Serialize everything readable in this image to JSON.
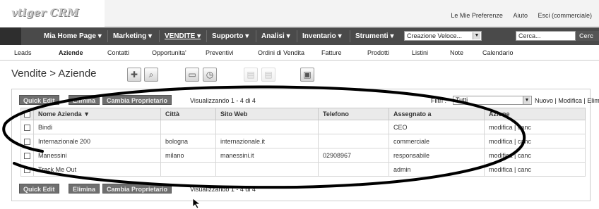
{
  "app": {
    "logo": "vtiger CRM"
  },
  "toplinks": {
    "preferences": "Le Mie Preferenze",
    "help": "Aiuto",
    "logout": "Esci (commerciale)"
  },
  "menu": {
    "items": [
      "Mia Home Page ▾",
      "Marketing ▾",
      "VENDITE ▾",
      "Supporto ▾",
      "Analisi ▾",
      "Inventario ▾",
      "Strumenti ▾"
    ],
    "quick_create": "Creazione Veloce...",
    "search_placeholder": "Cerca...",
    "search_button": "Cerc"
  },
  "subnav": [
    "Leads",
    "Aziende",
    "Contatti",
    "Opportunita'",
    "Preventivi",
    "Ordini di Vendita",
    "Fatture",
    "Prodotti",
    "Listini",
    "Note",
    "Calendario"
  ],
  "page": {
    "title": "Vendite > Aziende"
  },
  "toolbar": {
    "icons": [
      "add-icon",
      "search-icon",
      "calendar-icon",
      "clock-icon",
      "import-icon",
      "export-icon",
      "merge-icon"
    ]
  },
  "actions": {
    "quick_edit": "Quick Edit",
    "delete": "Elimina",
    "change_owner": "Cambia Proprietario",
    "paging": "Visualizzando 1 - 4 di 4"
  },
  "filter": {
    "label": "Filtri :",
    "value": "Tutti",
    "links": "Nuovo | Modifica | Elimina"
  },
  "table": {
    "headers": [
      "Nome Azienda ▼",
      "Città",
      "Sito Web",
      "Telefono",
      "Assegnato a",
      "Azione"
    ],
    "rows": [
      {
        "name": "Bindi",
        "city": "",
        "web": "",
        "phone": "",
        "assigned": "CEO",
        "action": "modifica | canc"
      },
      {
        "name": "Internazionale 200",
        "city": "bologna",
        "web": "internazionale.it",
        "phone": "",
        "assigned": "commerciale",
        "action": "modifica | canc"
      },
      {
        "name": "Manessini",
        "city": "milano",
        "web": "manessini.it",
        "phone": "02908967",
        "assigned": "responsabile",
        "action": "modifica | canc"
      },
      {
        "name": "Track Me Out",
        "city": "",
        "web": "",
        "phone": "",
        "assigned": "admin",
        "action": "modifica | canc"
      }
    ]
  },
  "colors": {
    "menubar": "#4a4a4a",
    "button": "#6f6f6f",
    "annotation": "#000000"
  }
}
